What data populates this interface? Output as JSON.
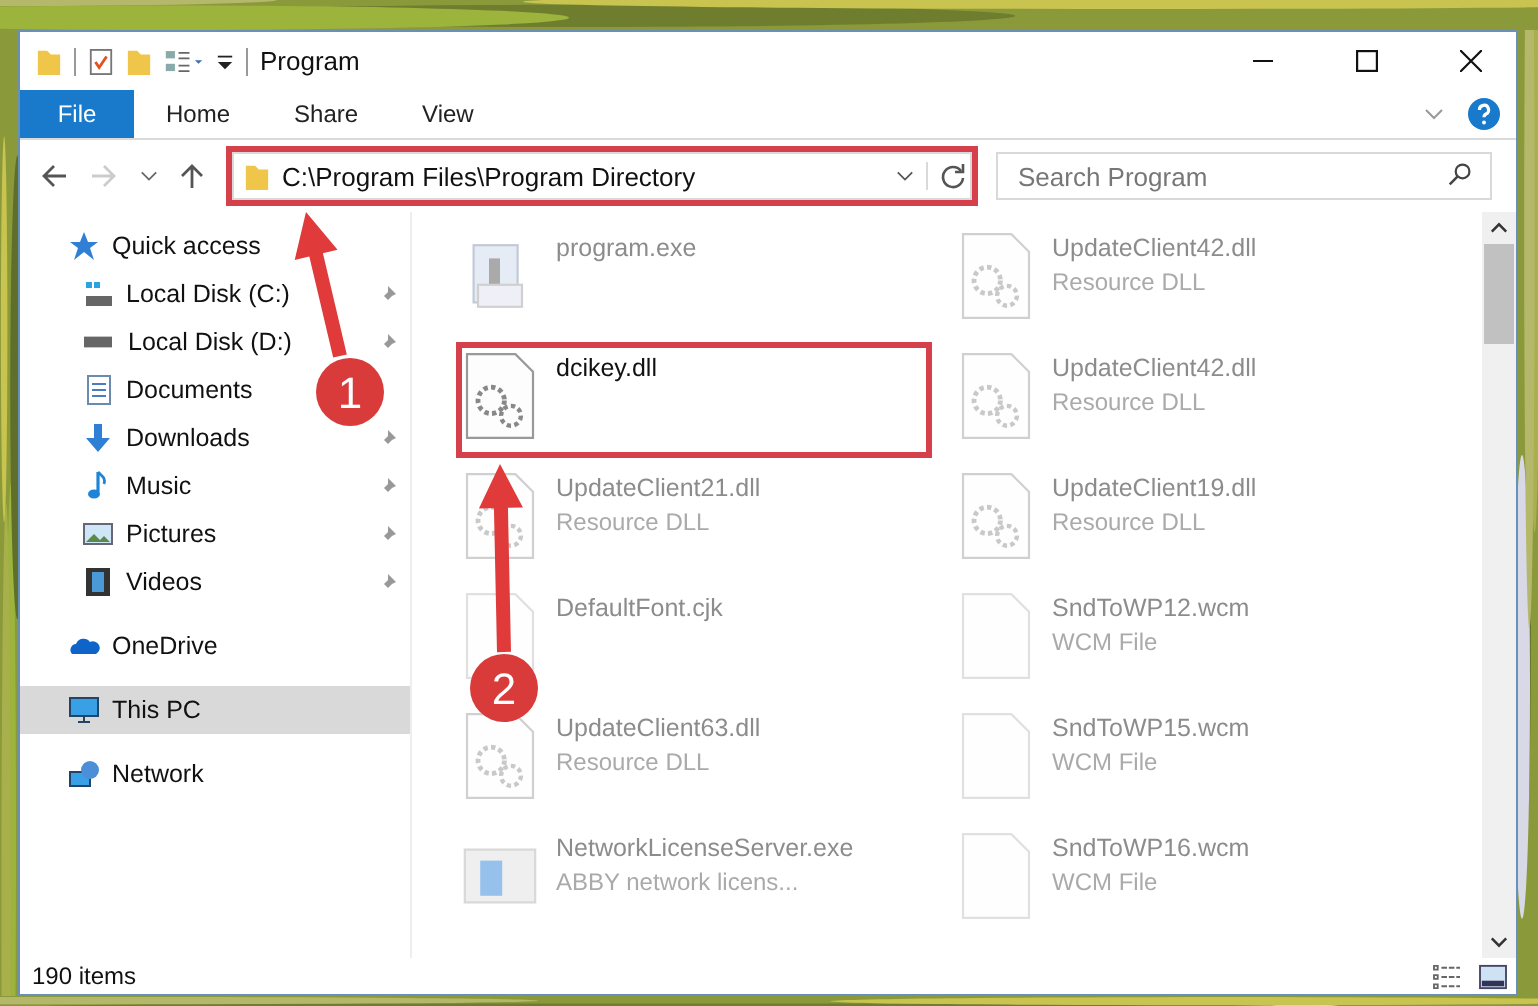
{
  "window": {
    "title": "Program"
  },
  "ribbon_tabs": [
    {
      "label": "File",
      "selected": true
    },
    {
      "label": "Home",
      "selected": false
    },
    {
      "label": "Share",
      "selected": false
    },
    {
      "label": "View",
      "selected": false
    }
  ],
  "address": {
    "value": "C:\\Program Files\\Program Directory"
  },
  "search": {
    "placeholder": "Search Program"
  },
  "sidebar": {
    "items": [
      {
        "label": "Quick access",
        "kind": "star",
        "selected": false,
        "children": [
          {
            "label": "Local Disk (C:)",
            "kind": "disk-c",
            "pinned": true,
            "selected": false
          },
          {
            "label": "Local Disk (D:)",
            "kind": "disk",
            "pinned": true,
            "selected": false
          },
          {
            "label": "Documents",
            "kind": "docs",
            "pinned": false,
            "selected": false
          },
          {
            "label": "Downloads",
            "kind": "download",
            "pinned": true,
            "selected": false
          },
          {
            "label": "Music",
            "kind": "music",
            "pinned": true,
            "selected": false
          },
          {
            "label": "Pictures",
            "kind": "pictures",
            "pinned": true,
            "selected": false
          },
          {
            "label": "Videos",
            "kind": "videos",
            "pinned": true,
            "selected": false
          }
        ]
      },
      {
        "label": "OneDrive",
        "kind": "cloud",
        "selected": false
      },
      {
        "label": "This PC",
        "kind": "pc",
        "selected": true
      },
      {
        "label": "Network",
        "kind": "network",
        "selected": false
      }
    ]
  },
  "files": [
    {
      "name": "program.exe",
      "kind": "exe",
      "faded": true
    },
    {
      "name": "UpdateClient42.dll",
      "type": "Resource DLL",
      "kind": "dll",
      "faded": true
    },
    {
      "name": "dcikey.dll",
      "kind": "dll",
      "faded": false
    },
    {
      "name": "UpdateClient42.dll",
      "type": "Resource DLL",
      "kind": "dll",
      "faded": true
    },
    {
      "name": "UpdateClient21.dll",
      "type": "Resource DLL",
      "kind": "dll",
      "faded": true
    },
    {
      "name": "UpdateClient19.dll",
      "type": "Resource DLL",
      "kind": "dll",
      "faded": true
    },
    {
      "name": "DefaultFont.cjk",
      "kind": "blank",
      "faded": true
    },
    {
      "name": "SndToWP12.wcm",
      "type": "WCM File",
      "kind": "blank",
      "faded": true
    },
    {
      "name": "UpdateClient63.dll",
      "type": "Resource DLL",
      "kind": "dll",
      "faded": true
    },
    {
      "name": "SndToWP15.wcm",
      "type": "WCM File",
      "kind": "blank",
      "faded": true
    },
    {
      "name": "NetworkLicenseServer.exe",
      "type": "ABBY network licens...",
      "kind": "app",
      "faded": true
    },
    {
      "name": "SndToWP16.wcm",
      "type": "WCM File",
      "kind": "blank",
      "faded": true
    }
  ],
  "status_bar": {
    "count": "190 items"
  },
  "callouts": [
    {
      "number": "1"
    },
    {
      "number": "2"
    }
  ]
}
